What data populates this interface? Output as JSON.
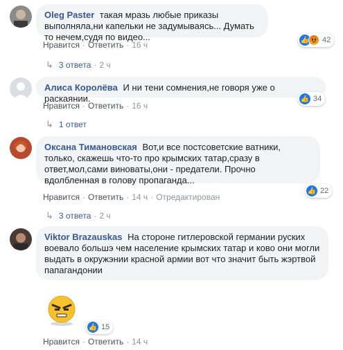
{
  "comments": [
    {
      "author": "Oleg Paster",
      "text": "такая мразь любые приказы выполняла,ни капельки не задумываясь... Думать то нечем,судя по видео...",
      "reaction_count": "42",
      "actions": {
        "like": "Нравится",
        "reply": "Ответить",
        "time": "16 ч"
      },
      "replies": {
        "label": "3 ответа",
        "time": "2 ч"
      }
    },
    {
      "author": "Алиса Королёва",
      "text": "И ни тени сомнения,не говоря уже о раскаянии.",
      "reaction_count": "34",
      "actions": {
        "like": "Нравится",
        "reply": "Ответить",
        "time": "16 ч"
      },
      "replies": {
        "label": "1 ответ"
      }
    },
    {
      "author": "Оксана Тимановская",
      "text": "Вот,и все постсоветские ватники, только, скажешь что-то про крымских татар,сразу в ответ,мол,сами виноваты,они - предатели. Прочно вдолбленная в голову пропаганда...",
      "reaction_count": "22",
      "actions": {
        "like": "Нравится",
        "reply": "Ответить",
        "time": "14 ч",
        "edited": "Отредактирован"
      },
      "replies": {
        "label": "3 ответа",
        "time": "2 ч"
      }
    },
    {
      "author": "Viktor Brazauskas",
      "text": "На стороне гитлеровской германии руских воевало большэ чем население крымских татар и ково они могли выдать в окружэнии красной армии вот что значит быть жэртвой папагандонии",
      "reaction_count": "15",
      "actions": {
        "like": "Нравится",
        "reply": "Ответить",
        "time": "14 ч"
      }
    }
  ],
  "icons": {
    "like": "thumbs-up-icon",
    "angry": "angry-icon",
    "reply_arrow": "reply-arrow-icon",
    "sticker": "angry-sticker"
  },
  "colors": {
    "author": "#385898",
    "bubble": "#f2f3f5",
    "like": "#1877f2",
    "meta": "#90949c"
  }
}
